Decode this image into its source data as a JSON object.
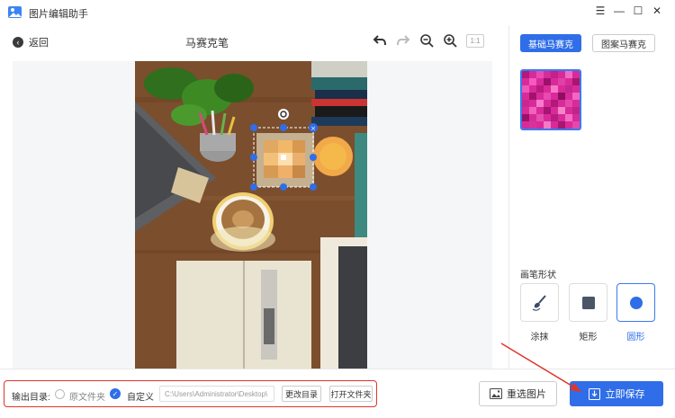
{
  "window": {
    "title": "图片编辑助手",
    "controls": [
      "menu",
      "minimize",
      "maximize",
      "close"
    ]
  },
  "toolbar": {
    "back_label": "返回",
    "page_title": "马赛克笔",
    "zoom_label": "1:1",
    "icons": [
      "undo-icon",
      "redo-icon",
      "zoom-out-icon",
      "zoom-in-icon"
    ]
  },
  "right_panel": {
    "tabs": [
      {
        "label": "基础马赛克",
        "active": true
      },
      {
        "label": "图案马赛克",
        "active": false
      }
    ],
    "brush_title": "画笔形状",
    "brushes": [
      {
        "label": "涂抹",
        "icon": "brush-icon",
        "active": false
      },
      {
        "label": "矩形",
        "icon": "square-icon",
        "active": false
      },
      {
        "label": "圆形",
        "icon": "circle-icon",
        "active": true
      }
    ]
  },
  "output": {
    "label": "输出目录:",
    "options": [
      {
        "label": "原文件夹",
        "checked": false
      },
      {
        "label": "自定义",
        "checked": true
      }
    ],
    "path_value": "C:\\Users\\Administrator\\Desktop\\",
    "change_dir_label": "更改目录",
    "open_folder_label": "打开文件夹"
  },
  "actions": {
    "reselect_label": "重选图片",
    "save_label": "立即保存"
  },
  "colors": {
    "accent": "#2f6ee8",
    "highlight_box": "#e0352b",
    "annotation_arrow": "#e0352b"
  }
}
